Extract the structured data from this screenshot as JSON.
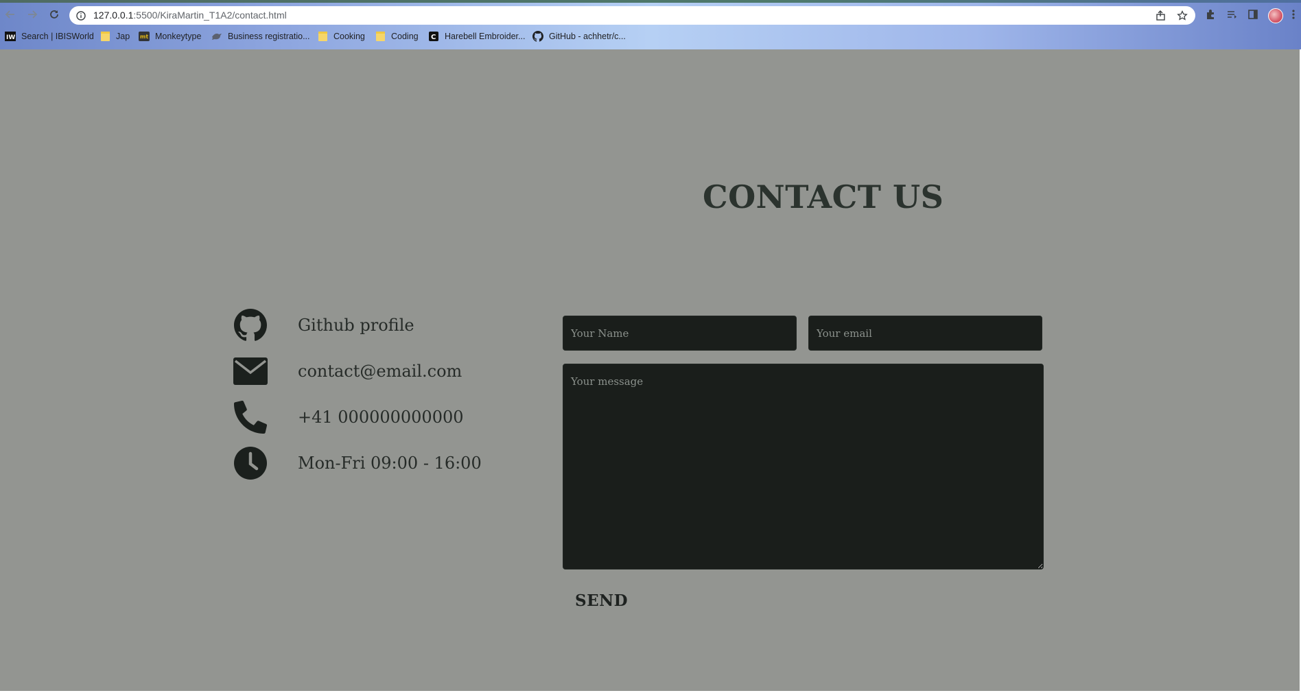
{
  "browser": {
    "url_host": "127.0.0.1",
    "url_rest": ":5500/KiraMartin_T1A2/contact.html",
    "bookmarks": [
      {
        "label": "Search | IBISWorld",
        "icon": "ibisworld-icon"
      },
      {
        "label": "Jap",
        "icon": "folder-icon"
      },
      {
        "label": "Monkeytype",
        "icon": "monkeytype-icon"
      },
      {
        "label": "Business registratio...",
        "icon": "bird-icon"
      },
      {
        "label": "Cooking",
        "icon": "folder-icon"
      },
      {
        "label": "Coding",
        "icon": "folder-icon"
      },
      {
        "label": "Harebell Embroider...",
        "icon": "c-logo-icon"
      },
      {
        "label": "GitHub - achhetr/c...",
        "icon": "github-icon"
      }
    ]
  },
  "page": {
    "title": "CONTACT US",
    "contact_items": [
      {
        "label": "Github profile",
        "icon": "github-icon"
      },
      {
        "label": "contact@email.com",
        "icon": "envelope-icon"
      },
      {
        "label": "+41 000000000000",
        "icon": "phone-icon"
      },
      {
        "label": "Mon-Fri 09:00 - 16:00",
        "icon": "clock-icon"
      }
    ],
    "form": {
      "name_placeholder": "Your Name",
      "email_placeholder": "Your email",
      "message_placeholder": "Your message",
      "send_label": "SEND"
    }
  },
  "colors": {
    "page_background": "#939591",
    "field_background": "#1a1e1b",
    "text_dark": "#2b332e"
  }
}
